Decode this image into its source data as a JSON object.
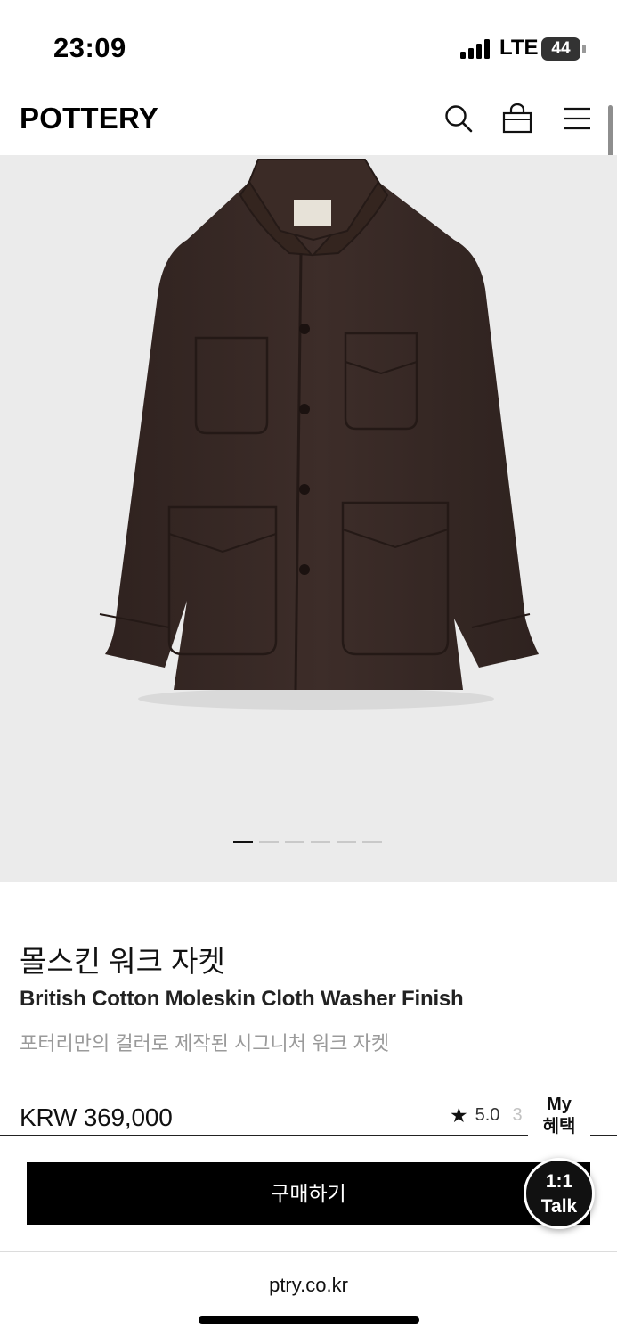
{
  "status_bar": {
    "time": "23:09",
    "network": "LTE",
    "battery": "44"
  },
  "header": {
    "logo": "POTTERY",
    "icons": [
      "search-icon",
      "shopping-bag-icon",
      "hamburger-menu-icon"
    ]
  },
  "gallery": {
    "total_images": 6,
    "active_index": 0
  },
  "product": {
    "title_ko": "몰스킨 워크 자켓",
    "subtitle_en": "British Cotton Moleskin Cloth Washer Finish",
    "description": "포터리만의 컬러로 제작된 시그니처 워크 자켓",
    "price": "KRW 369,000",
    "rating": "5.0",
    "rating_overflow": "3",
    "colors": {
      "jacket": "#3a2b27",
      "hero_bg": "#ebebeb"
    }
  },
  "floating": {
    "my_benefit_line1": "My",
    "my_benefit_line2": "혜택",
    "talk_line1": "1:1",
    "talk_line2": "Talk"
  },
  "actions": {
    "buy_label": "구매하기"
  },
  "browser": {
    "url": "ptry.co.kr"
  }
}
